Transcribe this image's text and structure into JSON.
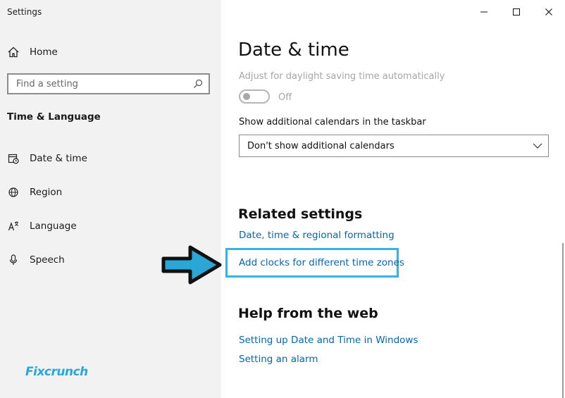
{
  "window": {
    "title": "Settings",
    "controls": [
      "minimize-icon",
      "maximize-icon",
      "close-icon"
    ]
  },
  "sidebar": {
    "home_label": "Home",
    "search": {
      "placeholder": "Find a setting",
      "value": ""
    },
    "section_title": "Time & Language",
    "items": [
      {
        "label": "Date & time",
        "icon": "calendar-clock-icon"
      },
      {
        "label": "Region",
        "icon": "globe-icon"
      },
      {
        "label": "Language",
        "icon": "language-icon"
      },
      {
        "label": "Speech",
        "icon": "microphone-icon"
      }
    ],
    "watermark": "Fixcrunch"
  },
  "main": {
    "title": "Date & time",
    "dst": {
      "label": "Adjust for daylight saving time automatically",
      "state": "Off"
    },
    "calendars": {
      "label": "Show additional calendars in the taskbar",
      "selected": "Don't show additional calendars"
    },
    "related": {
      "heading": "Related settings",
      "links": [
        "Date, time & regional formatting",
        "Add clocks for different time zones"
      ]
    },
    "help": {
      "heading": "Help from the web",
      "links": [
        "Setting up Date and Time in Windows",
        "Setting an alarm"
      ]
    }
  },
  "colors": {
    "accent_link": "#0067b8",
    "highlight": "#36b3e0",
    "sidebar_bg": "#f2f2f2",
    "disabled_text": "#a6a6a6"
  }
}
